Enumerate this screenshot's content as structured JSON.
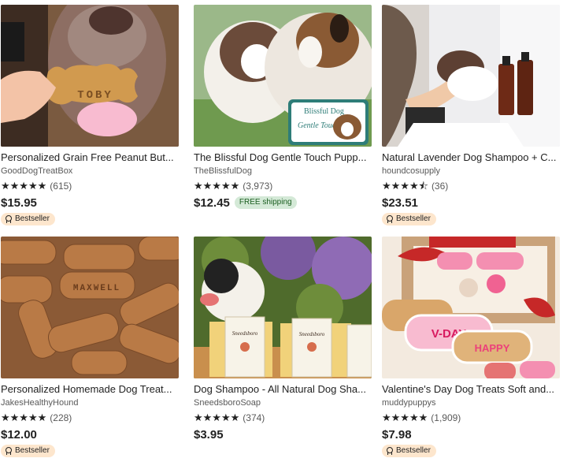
{
  "products": [
    {
      "title": "Personalized Grain Free Peanut But...",
      "shop": "GoodDogTreatBox",
      "stars": "★★★★★",
      "reviews": "(615)",
      "price": "$15.95",
      "badge": "Bestseller",
      "image_text": "TOBY"
    },
    {
      "title": "The Blissful Dog Gentle Touch Pupp...",
      "shop": "TheBlissfulDog",
      "stars": "★★★★★",
      "reviews": "(3,973)",
      "price": "$12.45",
      "shipping": "FREE shipping",
      "image_text": "Blissful Dog",
      "image_text2": "Gentle Touch"
    },
    {
      "title": "Natural Lavender Dog Shampoo + C...",
      "shop": "houndcosupply",
      "stars": "★★★★⯪",
      "reviews": "(36)",
      "price": "$23.51",
      "badge": "Bestseller"
    },
    {
      "title": "Personalized Homemade Dog Treat...",
      "shop": "JakesHealthyHound",
      "stars": "★★★★★",
      "reviews": "(228)",
      "price": "$12.00",
      "badge": "Bestseller",
      "image_text": "MAXWELL"
    },
    {
      "title": "Dog Shampoo - All Natural Dog Sha...",
      "shop": "SneedsboroSoap",
      "stars": "★★★★★",
      "reviews": "(374)",
      "price": "$3.95",
      "image_text": "Sneedsboro",
      "image_text2": "Dapper Danes Dog Shampoo"
    },
    {
      "title": "Valentine's Day Dog Treats Soft and...",
      "shop": "muddypuppys",
      "stars": "★★★★★",
      "reviews": "(1,909)",
      "price": "$7.98",
      "badge": "Bestseller",
      "image_text": "V-DAY",
      "image_text2": "HAPPY"
    }
  ]
}
